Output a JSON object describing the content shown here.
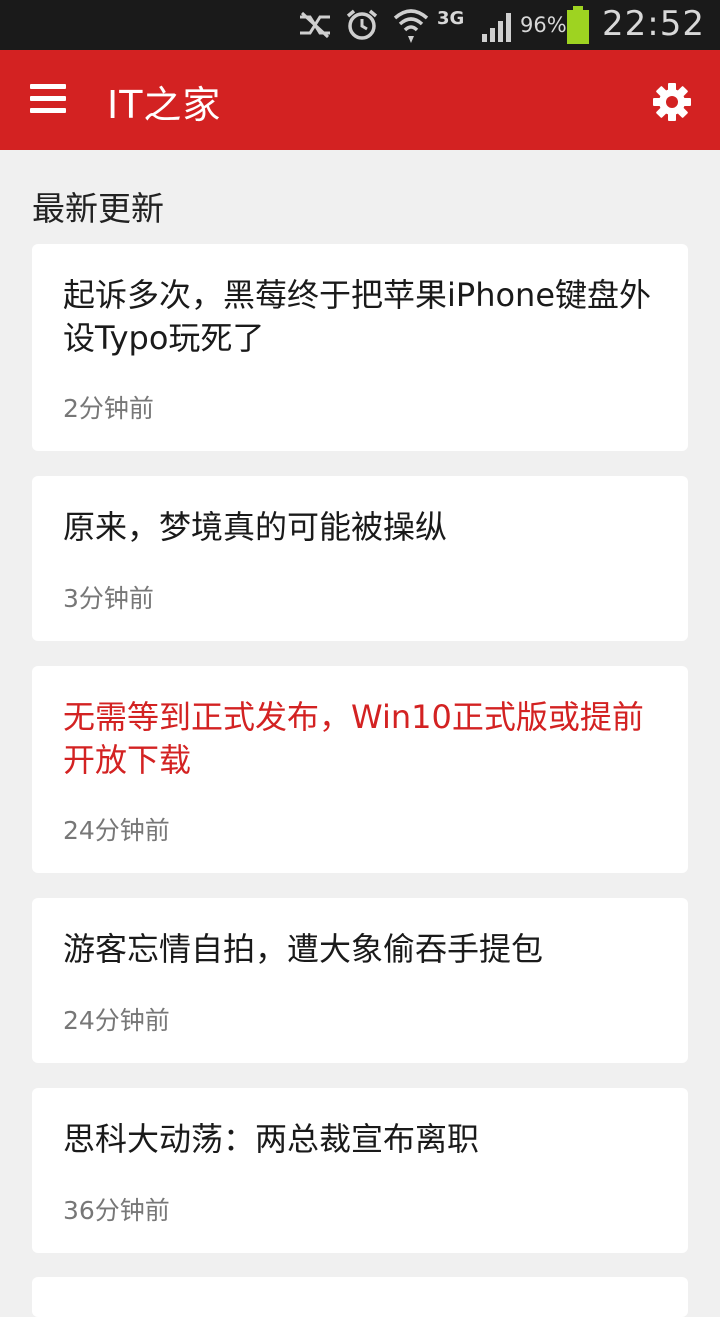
{
  "status_bar": {
    "network": "3G",
    "battery_percent": "96%",
    "time": "22:52",
    "icons": [
      "signal-off-icon",
      "alarm-icon",
      "wifi-icon",
      "cell-signal-icon",
      "battery-icon"
    ],
    "battery_color": "#9ed321"
  },
  "app_bar": {
    "title": "IT之家",
    "background": "#d32222"
  },
  "section": {
    "title": "最新更新"
  },
  "articles": [
    {
      "title": "起诉多次，黑莓终于把苹果iPhone键盘外设Typo玩死了",
      "time": "2分钟前",
      "highlighted": false
    },
    {
      "title": "原来，梦境真的可能被操纵",
      "time": "3分钟前",
      "highlighted": false
    },
    {
      "title": "无需等到正式发布，Win10正式版或提前开放下载",
      "time": "24分钟前",
      "highlighted": true
    },
    {
      "title": "游客忘情自拍，遭大象偷吞手提包",
      "time": "24分钟前",
      "highlighted": false
    },
    {
      "title": "思科大动荡：两总裁宣布离职",
      "time": "36分钟前",
      "highlighted": false
    }
  ]
}
